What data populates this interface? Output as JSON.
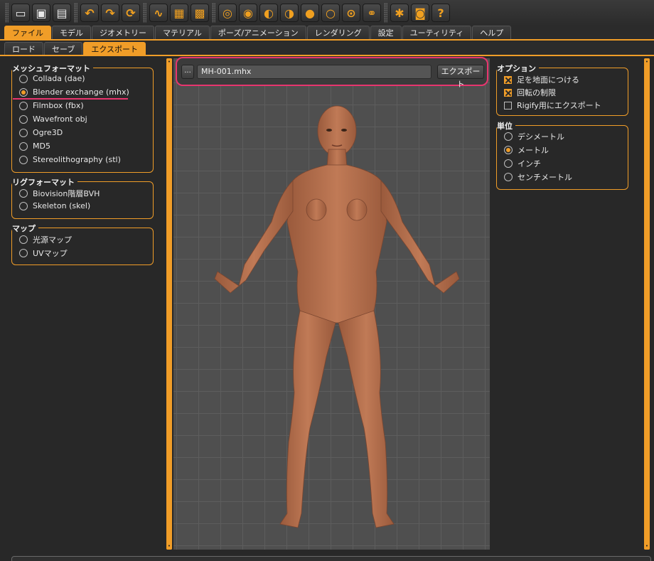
{
  "toolbar": {
    "buttons": [
      {
        "name": "new-icon",
        "glyph": "▭"
      },
      {
        "name": "save-icon",
        "glyph": "▣"
      },
      {
        "name": "export-icon",
        "glyph": "▤"
      },
      {
        "name": "undo-icon",
        "glyph": "↶"
      },
      {
        "name": "redo-icon",
        "glyph": "↷"
      },
      {
        "name": "reset-icon",
        "glyph": "⟳"
      },
      {
        "name": "smooth-icon",
        "glyph": "∿"
      },
      {
        "name": "wireframe-icon",
        "glyph": "▦"
      },
      {
        "name": "background-icon",
        "glyph": "▩"
      },
      {
        "name": "front-view-icon",
        "glyph": "◎"
      },
      {
        "name": "back-view-icon",
        "glyph": "◉"
      },
      {
        "name": "left-view-icon",
        "glyph": "◐"
      },
      {
        "name": "right-view-icon",
        "glyph": "◑"
      },
      {
        "name": "top-view-icon",
        "glyph": "●"
      },
      {
        "name": "bottom-view-icon",
        "glyph": "○"
      },
      {
        "name": "reset-camera-icon",
        "glyph": "⊙"
      },
      {
        "name": "symmetry-icon",
        "glyph": "⚭"
      },
      {
        "name": "pose-icon",
        "glyph": "✱"
      },
      {
        "name": "screenshot-icon",
        "glyph": "◙"
      },
      {
        "name": "help-icon",
        "glyph": "?"
      }
    ]
  },
  "tabs": [
    "ファイル",
    "モデル",
    "ジオメトリー",
    "マテリアル",
    "ポーズ/アニメーション",
    "レンダリング",
    "設定",
    "ユーティリティ",
    "ヘルプ"
  ],
  "active_tab": "ファイル",
  "subtabs": [
    "ロード",
    "セーブ",
    "エクスポート"
  ],
  "active_subtab": "エクスポート",
  "mesh_format": {
    "title": "メッシュフォーマット",
    "options": [
      "Collada (dae)",
      "Blender exchange (mhx)",
      "Filmbox (fbx)",
      "Wavefront obj",
      "Ogre3D",
      "MD5",
      "Stereolithography (stl)"
    ],
    "selected": "Blender exchange (mhx)"
  },
  "rig_format": {
    "title": "リグフォーマット",
    "options": [
      "Biovision階層BVH",
      "Skeleton (skel)"
    ]
  },
  "maps": {
    "title": "マップ",
    "options": [
      "光源マップ",
      "UVマップ"
    ]
  },
  "file": {
    "browse_label": "...",
    "filename": "MH-001.mhx",
    "export_label": "エクスポート"
  },
  "options": {
    "title": "オプション",
    "items": [
      {
        "label": "足を地面につける",
        "checked": true
      },
      {
        "label": "回転の制限",
        "checked": true
      },
      {
        "label": "Rigify用にエクスポート",
        "checked": false
      }
    ]
  },
  "units": {
    "title": "単位",
    "options": [
      "デシメートル",
      "メートル",
      "インチ",
      "センチメートル"
    ],
    "selected": "メートル"
  },
  "colors": {
    "accent": "#f09d28",
    "highlight": "#e8356e",
    "skin": "#b8714e"
  }
}
